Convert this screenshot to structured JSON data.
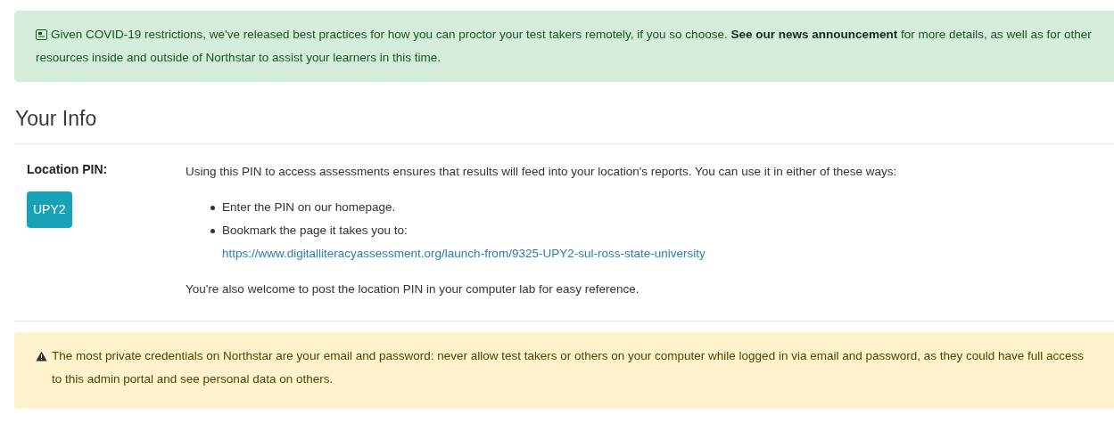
{
  "notice": {
    "text": "Given COVID-19 restrictions, we've released best practices for how you can proctor your test takers remotely, if you so choose. **See our news announcement** for more details, as well as for other resources inside and outside of Northstar to assist your learners in this time."
  },
  "heading": "Your Info",
  "location_pin": {
    "label": "Location PIN:",
    "pin": "UPY2",
    "intro": "Using this PIN to access assessments ensures that results will feed into your location's reports. You can use it in either of these ways:",
    "ways": [
      {
        "text": "Enter the PIN on our homepage."
      },
      {
        "text": "Bookmark the page it takes you to:",
        "link": "https://www.digitalliteracyassessment.org/launch-from/9325-UPY2-sul-ross-state-university"
      }
    ],
    "footer": "You're also welcome to post the location PIN in your computer lab for easy reference."
  },
  "warning": {
    "text": "The most private credentials on Northstar are your email and password: never allow test takers or others on your computer while logged in via email and password, as they could have full access to this admin portal and see personal data on others."
  }
}
